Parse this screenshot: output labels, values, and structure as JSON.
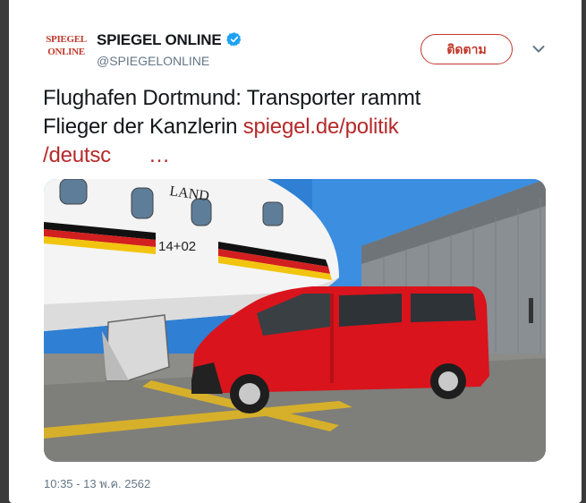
{
  "account": {
    "avatar_line1": "SPIEGEL",
    "avatar_line2": "ONLINE",
    "name": "SPIEGEL ONLINE",
    "handle": "@SPIEGELONLINE",
    "verified_icon": "verified-badge-icon"
  },
  "follow_button": {
    "label": "ติดตาม"
  },
  "menu": {
    "icon": "chevron-down-icon"
  },
  "tweet": {
    "line1": "Flughafen Dortmund: Transporter rammt",
    "line2_text": "Flieger der Kanzlerin ",
    "line2_link": "spiegel.de/politik",
    "line3_link": "/deutsc",
    "line3_ellipsis": "…"
  },
  "photo": {
    "aircraft_lettering": "LAND",
    "aircraft_number": "14+02"
  },
  "timestamp": "10:35 - 13 พ.ค. 2562",
  "colors": {
    "brand_red": "#c0392b",
    "link_red": "#b5292a",
    "verified_blue": "#1da1f2",
    "text_dark": "#14171a",
    "text_muted": "#657786"
  }
}
